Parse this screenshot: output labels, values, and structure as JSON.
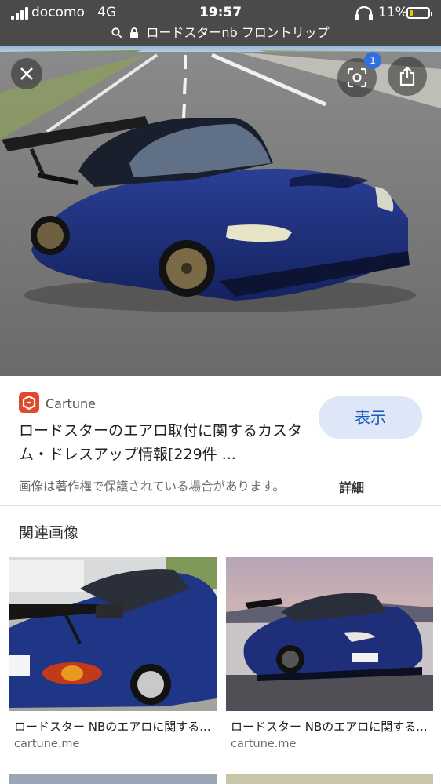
{
  "status_bar": {
    "carrier": "docomo",
    "network": "4G",
    "time": "19:57",
    "battery": "11%"
  },
  "url_bar": {
    "text": "ロードスターnb フロントリップ"
  },
  "badge_count": "1",
  "source": {
    "name": "Cartune"
  },
  "result": {
    "title": "ロードスターのエアロ取付に関するカスタム・ドレスアップ情報[229件 ...",
    "view_label": "表示"
  },
  "copyright": {
    "notice": "画像は著作権で保護されている場合があります。",
    "details_label": "詳細"
  },
  "related": {
    "title": "関連画像",
    "items": [
      {
        "caption": "ロードスター NBのエアロに関する...",
        "domain": "cartune.me"
      },
      {
        "caption": "ロードスター NBのエアロに関する...",
        "domain": "cartune.me"
      }
    ]
  },
  "colors": {
    "status_bg": "#4a4a4a",
    "accent": "#1a5ab8",
    "button_bg": "#dde7f8",
    "car_blue": "#1d2f7a",
    "logo": "#e04a2c"
  },
  "icons": [
    "close-icon",
    "lens-icon",
    "share-icon",
    "lock-icon",
    "search-icon",
    "headphones-icon",
    "battery-icon"
  ]
}
